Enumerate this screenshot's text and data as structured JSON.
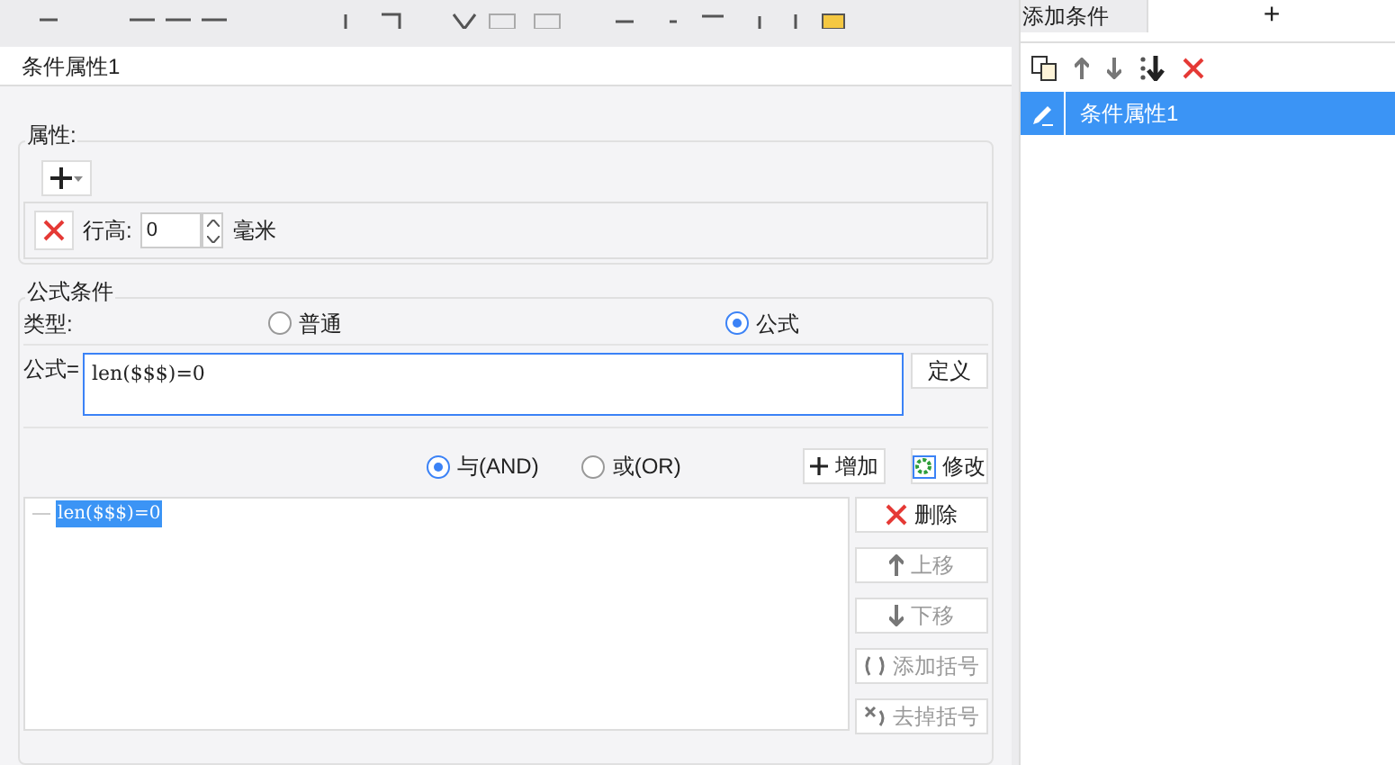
{
  "title": "条件属性1",
  "properties": {
    "label": "属性:",
    "row": {
      "label": "行高:",
      "value": "0",
      "unit": "毫米"
    }
  },
  "formula_condition": {
    "label": "公式条件",
    "type_label": "类型:",
    "types": [
      {
        "label": "普通",
        "selected": false
      },
      {
        "label": "公式",
        "selected": true
      }
    ],
    "formula_label": "公式=",
    "formula_value": "len($$$)=0",
    "define_button": "定义",
    "logic": [
      {
        "label": "与(AND)",
        "selected": true
      },
      {
        "label": "或(OR)",
        "selected": false
      }
    ],
    "add_button": "增加",
    "modify_button": "修改",
    "conditions": [
      {
        "text": "len($$$)=0",
        "selected": true
      }
    ],
    "side_buttons": [
      {
        "label": "删除",
        "kind": "delete",
        "disabled": false
      },
      {
        "label": "上移",
        "kind": "up",
        "disabled": true
      },
      {
        "label": "下移",
        "kind": "down",
        "disabled": true
      },
      {
        "label": "添加括号",
        "kind": "paren",
        "disabled": true
      },
      {
        "label": "去掉括号",
        "kind": "unparen",
        "disabled": true
      }
    ]
  },
  "right_panel": {
    "tab": "添加条件",
    "add": "+",
    "items": [
      {
        "label": "条件属性1",
        "selected": true
      }
    ]
  }
}
